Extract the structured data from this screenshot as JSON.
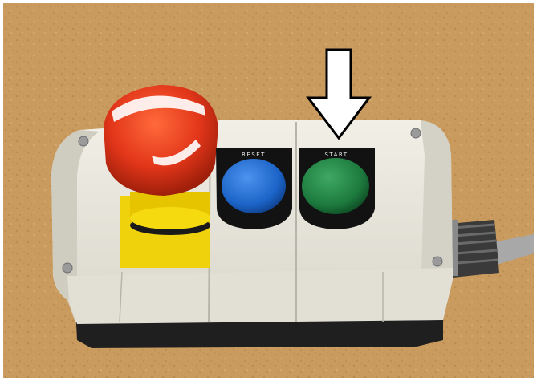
{
  "scene": {
    "description_free": true,
    "colors": {
      "cork": "#c79a5c",
      "enclosure": "#e9e7dd",
      "enclosure_base": "#232323",
      "estop_red": "#e0361a",
      "estop_yellow": "#f2d600",
      "reset_blue": "#1c64c8",
      "start_green": "#1d7a3e",
      "bezel": "#121212",
      "arrow": "#ffffff"
    },
    "buttons": [
      {
        "name": "emergency-stop",
        "label": ""
      },
      {
        "name": "reset",
        "label": "RESET"
      },
      {
        "name": "start",
        "label": "START"
      }
    ]
  }
}
